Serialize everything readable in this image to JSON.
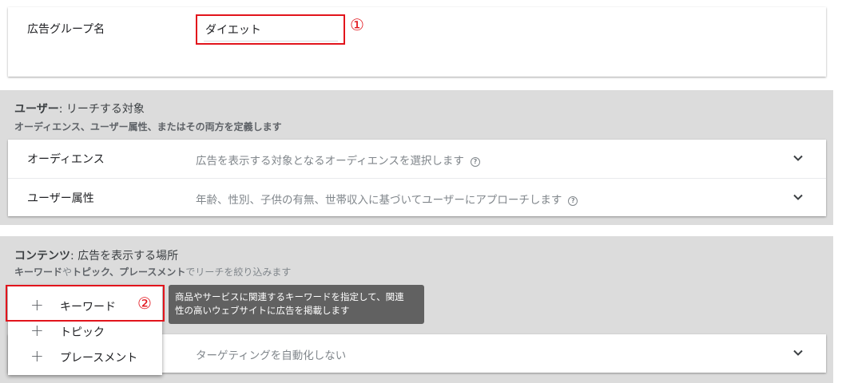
{
  "ad_group": {
    "label": "広告グループ名",
    "value": "ダイエット",
    "marker": "①"
  },
  "user_section": {
    "title_bold": "ユーザー",
    "title_rest": ": リーチする対象",
    "subtitle": "オーディエンス、ユーザー属性、またはその両方を定義します",
    "rows": [
      {
        "label": "オーディエンス",
        "description": "広告を表示する対象となるオーディエンスを選択します",
        "icon": "help-icon"
      },
      {
        "label": "ユーザー属性",
        "description": "年齢、性別、子供の有無、世帯収入に基づいてユーザーにアプローチします",
        "icon": "help-icon"
      }
    ]
  },
  "content_section": {
    "title_bold": "コンテンツ",
    "title_rest": ": 広告を表示する場所",
    "subtitle_part1": "キーワード",
    "subtitle_part2": "や",
    "subtitle_part3": "トピック",
    "subtitle_part4": "、",
    "subtitle_part5": "プレースメント",
    "subtitle_part6": "でリーチを絞り込みます",
    "auto_targeting": "ターゲティングを自動化しない"
  },
  "menu": {
    "items": [
      {
        "plus": "+",
        "label": "キーワード"
      },
      {
        "plus": "+",
        "label": "トピック"
      },
      {
        "plus": "+",
        "label": "プレースメント"
      }
    ],
    "marker": "②"
  },
  "tooltip": {
    "line1": "商品やサービスに関連するキーワードを指定して、関連",
    "line2": "性の高いウェブサイトに広告を掲載します"
  },
  "colors": {
    "annotation_red": "#e2141c",
    "section_gray": "#dcdcdc",
    "tooltip_bg": "#616161"
  }
}
